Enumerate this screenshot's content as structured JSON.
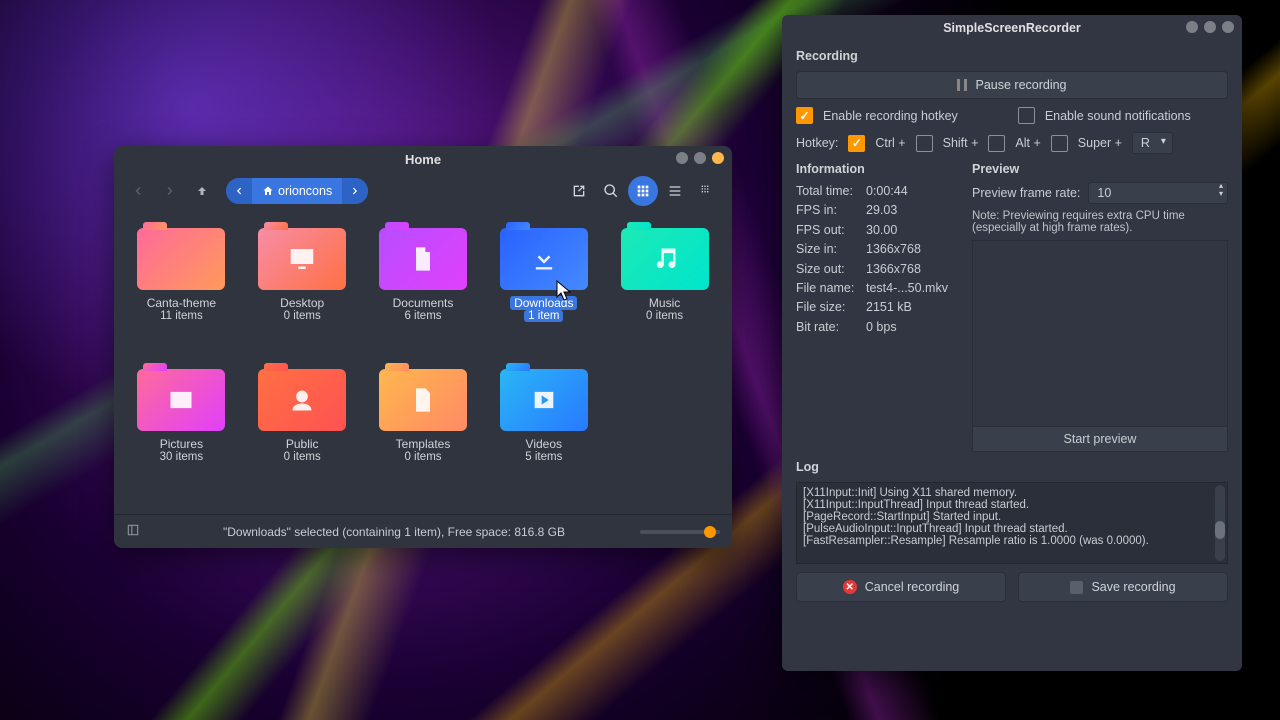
{
  "filemanager": {
    "title": "Home",
    "location": "orioncons",
    "folders": [
      {
        "name": "Canta-theme",
        "count": "11 items",
        "grad": "linear-gradient(135deg,#ff6a9a,#ff9a5a)",
        "glyph": ""
      },
      {
        "name": "Desktop",
        "count": "0 items",
        "grad": "linear-gradient(135deg,#f78da7,#ff7043)",
        "glyph": "desktop"
      },
      {
        "name": "Documents",
        "count": "6 items",
        "grad": "linear-gradient(135deg,#b84dff,#e040fb)",
        "glyph": "doc"
      },
      {
        "name": "Downloads",
        "count": "1 item",
        "grad": "linear-gradient(135deg,#2962ff,#448aff)",
        "glyph": "download",
        "selected": true
      },
      {
        "name": "Music",
        "count": "0 items",
        "grad": "linear-gradient(135deg,#1de9b6,#00e5cc)",
        "glyph": "music"
      },
      {
        "name": "Pictures",
        "count": "30 items",
        "grad": "linear-gradient(135deg,#ff6a9a,#e040fb)",
        "glyph": "pic"
      },
      {
        "name": "Public",
        "count": "0 items",
        "grad": "linear-gradient(135deg,#ff7043,#ff5252)",
        "glyph": "public"
      },
      {
        "name": "Templates",
        "count": "0 items",
        "grad": "linear-gradient(135deg,#ffb74d,#ff8a65)",
        "glyph": "template"
      },
      {
        "name": "Videos",
        "count": "5 items",
        "grad": "linear-gradient(135deg,#29b6f6,#2979ff)",
        "glyph": "video"
      }
    ],
    "status": "\"Downloads\" selected (containing 1 item), Free space: 816.8 GB"
  },
  "ssr": {
    "title": "SimpleScreenRecorder",
    "recording_label": "Recording",
    "pause_label": "Pause recording",
    "enable_hotkey": "Enable recording hotkey",
    "enable_sound": "Enable sound notifications",
    "hotkey_label": "Hotkey:",
    "hk_ctrl": "Ctrl +",
    "hk_shift": "Shift +",
    "hk_alt": "Alt +",
    "hk_super": "Super +",
    "hk_key": "R",
    "information_label": "Information",
    "info": [
      {
        "label": "Total time:",
        "value": "0:00:44"
      },
      {
        "label": "FPS in:",
        "value": "29.03"
      },
      {
        "label": "FPS out:",
        "value": "30.00"
      },
      {
        "label": "Size in:",
        "value": "1366x768"
      },
      {
        "label": "Size out:",
        "value": "1366x768"
      },
      {
        "label": "File name:",
        "value": "test4-...50.mkv"
      },
      {
        "label": "File size:",
        "value": "2151 kB"
      },
      {
        "label": "Bit rate:",
        "value": "0 bps"
      }
    ],
    "preview_label": "Preview",
    "preview_rate_label": "Preview frame rate:",
    "preview_rate": "10",
    "preview_note": "Note: Previewing requires extra CPU time (especially at high frame rates).",
    "start_preview": "Start preview",
    "log_label": "Log",
    "log_lines": [
      "[X11Input::Init] Using X11 shared memory.",
      "[X11Input::InputThread] Input thread started.",
      "[PageRecord::StartInput] Started input.",
      "[PulseAudioInput::InputThread] Input thread started.",
      "[FastResampler::Resample] Resample ratio is 1.0000 (was 0.0000)."
    ],
    "cancel_label": "Cancel recording",
    "save_label": "Save recording"
  }
}
